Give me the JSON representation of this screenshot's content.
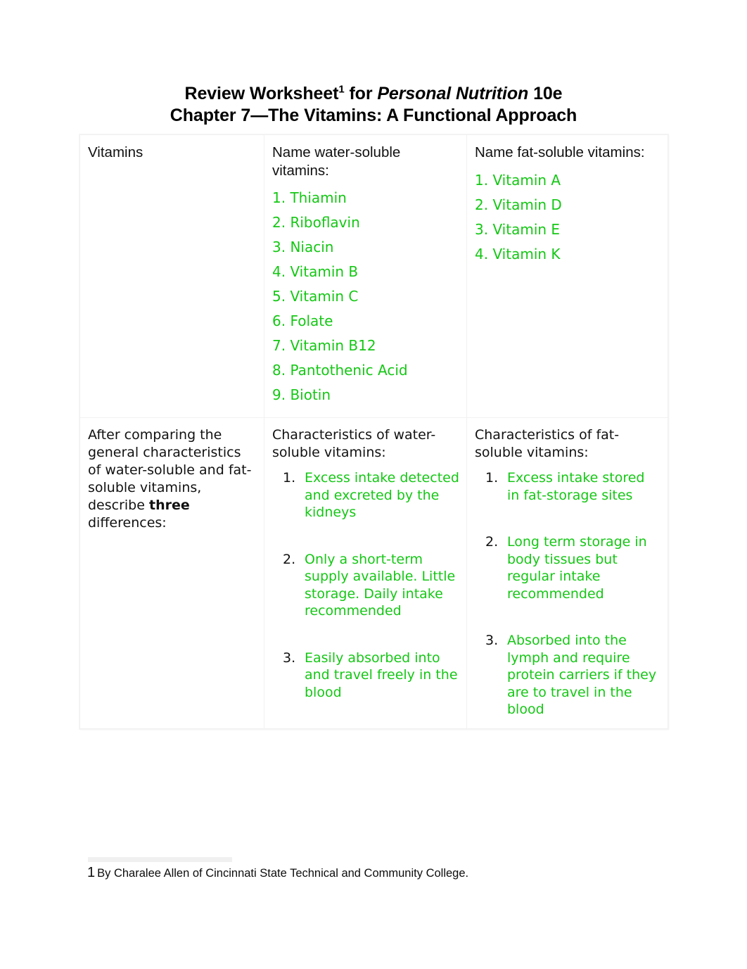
{
  "document": {
    "title_line1_pre": "Review Worksheet",
    "title_line1_sup": "1",
    "title_line1_mid": " for ",
    "title_line1_italic": "Personal Nutrition",
    "title_line1_post": " 10e",
    "title_line2": "Chapter 7—The Vitamins: A Functional Approach",
    "accent_green": "#15c715",
    "text_black": "#111111",
    "page_background": "#ffffff"
  },
  "table": {
    "row1": {
      "cell_a_label": "Vitamins",
      "cell_b_label": "Name water-soluble vitamins:",
      "cell_c_label": "Name fat-soluble vitamins:",
      "water_soluble_vitamins": [
        "1. Thiamin",
        "2. Riboflavin",
        "3. Niacin",
        "4. Vitamin B",
        "5. Vitamin C",
        "6. Folate",
        "7. Vitamin B12",
        "8. Pantothenic Acid",
        "9. Biotin"
      ],
      "fat_soluble_vitamins": [
        "1. Vitamin A",
        "2. Vitamin D",
        "3. Vitamin E",
        "4. Vitamin K"
      ]
    },
    "row2": {
      "prompt_pre": "After comparing the general characteristics of water-soluble and fat-soluble vitamins, describe ",
      "prompt_bold": "three",
      "prompt_post": " differences:",
      "cell_b_label": "Characteristics of water-soluble vitamins:",
      "cell_c_label": "Characteristics of fat-soluble vitamins:",
      "water_soluble_characteristics": [
        "Excess intake detected and excreted by the kidneys",
        "Only a short-term supply available. Little storage. Daily intake recommended",
        "Easily absorbed into and travel freely in the blood"
      ],
      "fat_soluble_characteristics": [
        "Excess intake stored in fat-storage sites",
        "Long term storage in body tissues but regular intake recommended",
        "Absorbed into the lymph and require protein carriers if they are to travel in the blood"
      ]
    }
  },
  "footnote": {
    "marker": "1",
    "text": "By Charalee Allen of Cincinnati State Technical and Community College."
  }
}
